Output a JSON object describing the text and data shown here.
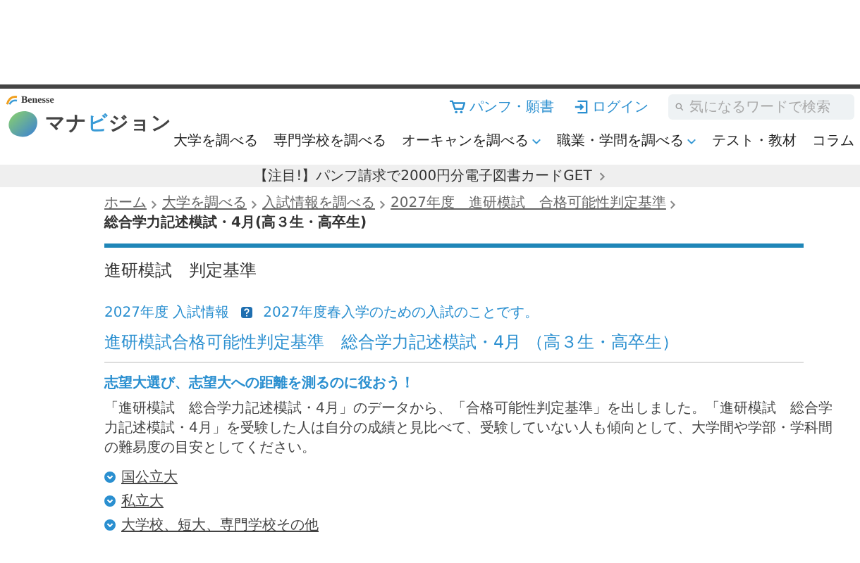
{
  "header": {
    "brand": "Benesse",
    "logo_parts": [
      {
        "text": "マナ",
        "accent": false
      },
      {
        "text": "ビ",
        "accent": true
      },
      {
        "text": "ジョン",
        "accent": false
      }
    ],
    "links": [
      {
        "kind": "cart",
        "label": "パンフ・願書"
      },
      {
        "kind": "login",
        "label": "ログイン"
      }
    ],
    "search": {
      "placeholder": "気になるワードで検索"
    },
    "nav": [
      {
        "label": "大学を調べる",
        "dropdown": false
      },
      {
        "label": "専門学校を調べる",
        "dropdown": false
      },
      {
        "label": "オーキャンを調べる",
        "dropdown": true
      },
      {
        "label": "職業・学問を調べる",
        "dropdown": true
      },
      {
        "label": "テスト・教材",
        "dropdown": false
      },
      {
        "label": "コラム",
        "dropdown": false
      }
    ]
  },
  "banner": "【注目!】パンフ請求で2000円分電子図書カードGET",
  "breadcrumb": [
    {
      "label": "ホーム",
      "current": false
    },
    {
      "label": "大学を調べる",
      "current": false
    },
    {
      "label": "入試情報を調べる",
      "current": false
    },
    {
      "label": "2027年度　進研模試　合格可能性判定基準",
      "current": false
    },
    {
      "label": "総合学力記述模試・4月(高３生・高卒生)",
      "current": true
    }
  ],
  "page_title": "進研模試　判定基準",
  "info": {
    "tag": "2027年度 入試情報",
    "note": "2027年度春入学のための入試のことです。"
  },
  "heading": "進研模試合格可能性判定基準　総合学力記述模試・4月 （高３生・高卒生）",
  "lead": "志望大選び、志望大への距離を測るのに役おう！",
  "paragraph": "「進研模試　総合学力記述模試・4月」のデータから、「合格可能性判定基準」を出しました。「進研模試　総合学力記述模試・4月」を受験した人は自分の成績と見比べて、受験していない人も傾向として、大学間や学部・学科間の難易度の目安としてください。",
  "links": [
    "国公立大",
    "私立大",
    "大学校、短大、専門学校その他"
  ]
}
